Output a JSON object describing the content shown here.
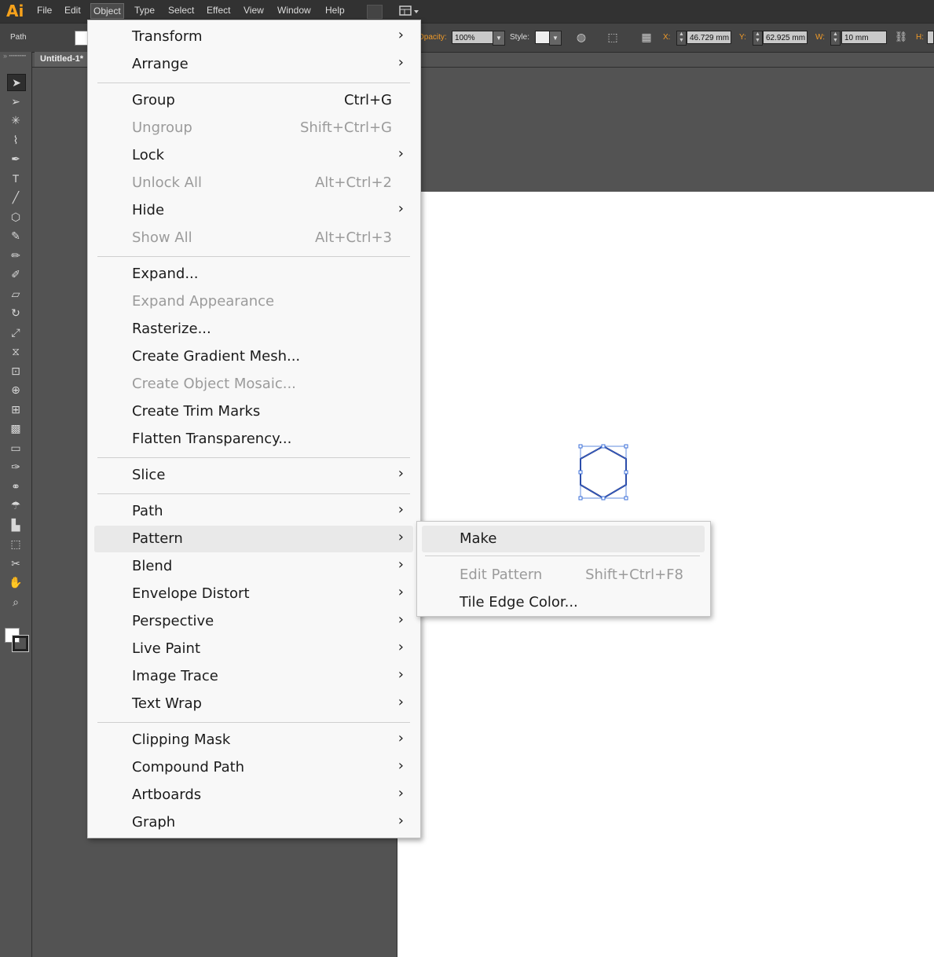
{
  "app": {
    "logo": "Ai"
  },
  "menubar": {
    "items": [
      "File",
      "Edit",
      "Object",
      "Type",
      "Select",
      "Effect",
      "View",
      "Window",
      "Help"
    ],
    "active": "Object"
  },
  "controlbar": {
    "selection_type": "Path",
    "opacity_label": "Opacity:",
    "opacity_value": "100%",
    "style_label": "Style:",
    "x_label": "X:",
    "x_value": "46.729 mm",
    "y_label": "Y:",
    "y_value": "62.925 mm",
    "w_label": "W:",
    "w_value": "10 mm",
    "h_label": "H:"
  },
  "document": {
    "tab_title": "Untitled-1*"
  },
  "object_menu": {
    "items": [
      {
        "label": "Transform",
        "shortcut": "",
        "submenu": true,
        "disabled": false
      },
      {
        "label": "Arrange",
        "shortcut": "",
        "submenu": true,
        "disabled": false
      },
      {
        "label": "Group",
        "shortcut": "Ctrl+G",
        "submenu": false,
        "disabled": false
      },
      {
        "label": "Ungroup",
        "shortcut": "Shift+Ctrl+G",
        "submenu": false,
        "disabled": true
      },
      {
        "label": "Lock",
        "shortcut": "",
        "submenu": true,
        "disabled": false
      },
      {
        "label": "Unlock All",
        "shortcut": "Alt+Ctrl+2",
        "submenu": false,
        "disabled": true
      },
      {
        "label": "Hide",
        "shortcut": "",
        "submenu": true,
        "disabled": false
      },
      {
        "label": "Show All",
        "shortcut": "Alt+Ctrl+3",
        "submenu": false,
        "disabled": true
      },
      {
        "label": "Expand...",
        "shortcut": "",
        "submenu": false,
        "disabled": false
      },
      {
        "label": "Expand Appearance",
        "shortcut": "",
        "submenu": false,
        "disabled": true
      },
      {
        "label": "Rasterize...",
        "shortcut": "",
        "submenu": false,
        "disabled": false
      },
      {
        "label": "Create Gradient Mesh...",
        "shortcut": "",
        "submenu": false,
        "disabled": false
      },
      {
        "label": "Create Object Mosaic...",
        "shortcut": "",
        "submenu": false,
        "disabled": true
      },
      {
        "label": "Create Trim Marks",
        "shortcut": "",
        "submenu": false,
        "disabled": false
      },
      {
        "label": "Flatten Transparency...",
        "shortcut": "",
        "submenu": false,
        "disabled": false
      },
      {
        "label": "Slice",
        "shortcut": "",
        "submenu": true,
        "disabled": false
      },
      {
        "label": "Path",
        "shortcut": "",
        "submenu": true,
        "disabled": false
      },
      {
        "label": "Pattern",
        "shortcut": "",
        "submenu": true,
        "disabled": false,
        "highlighted": true
      },
      {
        "label": "Blend",
        "shortcut": "",
        "submenu": true,
        "disabled": false
      },
      {
        "label": "Envelope Distort",
        "shortcut": "",
        "submenu": true,
        "disabled": false
      },
      {
        "label": "Perspective",
        "shortcut": "",
        "submenu": true,
        "disabled": false
      },
      {
        "label": "Live Paint",
        "shortcut": "",
        "submenu": true,
        "disabled": false
      },
      {
        "label": "Image Trace",
        "shortcut": "",
        "submenu": true,
        "disabled": false
      },
      {
        "label": "Text Wrap",
        "shortcut": "",
        "submenu": true,
        "disabled": false
      },
      {
        "label": "Clipping Mask",
        "shortcut": "",
        "submenu": true,
        "disabled": false
      },
      {
        "label": "Compound Path",
        "shortcut": "",
        "submenu": true,
        "disabled": false
      },
      {
        "label": "Artboards",
        "shortcut": "",
        "submenu": true,
        "disabled": false
      },
      {
        "label": "Graph",
        "shortcut": "",
        "submenu": true,
        "disabled": false
      }
    ],
    "arrow_glyph": "›"
  },
  "pattern_submenu": {
    "items": [
      {
        "label": "Make",
        "shortcut": "",
        "disabled": false,
        "highlighted": true
      },
      {
        "label": "Edit Pattern",
        "shortcut": "Shift+Ctrl+F8",
        "disabled": true
      },
      {
        "label": "Tile Edge Color...",
        "shortcut": "",
        "disabled": false
      }
    ]
  },
  "tools": [
    "selection-tool",
    "direct-selection-tool",
    "magic-wand-tool",
    "lasso-tool",
    "pen-tool",
    "type-tool",
    "line-segment-tool",
    "polygon-tool",
    "paintbrush-tool",
    "pencil-tool",
    "blob-brush-tool",
    "eraser-tool",
    "rotate-tool",
    "scale-tool",
    "width-tool",
    "free-transform-tool",
    "shape-builder-tool",
    "perspective-grid-tool",
    "mesh-tool",
    "gradient-tool",
    "eyedropper-tool",
    "blend-tool",
    "symbol-sprayer-tool",
    "column-graph-tool",
    "artboard-tool",
    "slice-tool",
    "hand-tool",
    "zoom-tool"
  ],
  "colors": {
    "menubar_bg": "#323232",
    "panel_bg": "#535353",
    "menu_bg": "#f8f8f8",
    "menu_highlight": "#e9e9e9",
    "disabled_text": "#9b9b9b",
    "label_orange": "#f09a28",
    "selection_blue": "#3b6fd8",
    "logo_orange": "#f7a21b"
  }
}
